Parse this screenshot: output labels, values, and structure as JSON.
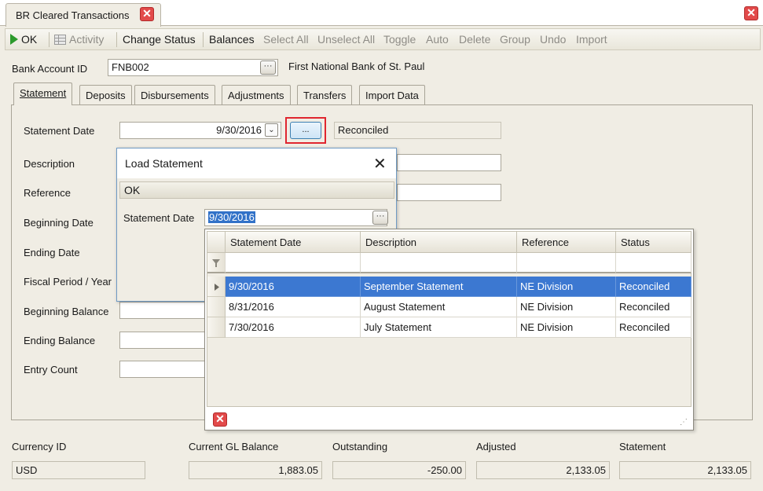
{
  "window": {
    "tab_title": "BR Cleared Transactions",
    "tab_close": "✕",
    "window_close": "✕"
  },
  "toolbar": {
    "ok": "OK",
    "activity": "Activity",
    "change_status": "Change Status",
    "balances": "Balances",
    "select_all": "Select All",
    "unselect_all": "Unselect All",
    "toggle": "Toggle",
    "auto": "Auto",
    "delete": "Delete",
    "group": "Group",
    "undo": "Undo",
    "import": "Import"
  },
  "header": {
    "bank_account_label": "Bank Account ID",
    "bank_account_value": "FNB002",
    "bank_name": "First National Bank of St. Paul"
  },
  "section_tabs": [
    "Statement",
    "Deposits",
    "Disbursements",
    "Adjustments",
    "Transfers",
    "Import Data"
  ],
  "statement_form": {
    "statement_date_label": "Statement Date",
    "statement_date_value": "9/30/2016",
    "lookup_button": "...",
    "status_value": "Reconciled",
    "description_label": "Description",
    "reference_label": "Reference",
    "beginning_date_label": "Beginning Date",
    "ending_date_label": "Ending Date",
    "fiscal_period_label": "Fiscal Period / Year",
    "beginning_balance_label": "Beginning Balance",
    "ending_balance_label": "Ending Balance",
    "entry_count_label": "Entry Count"
  },
  "load_dialog": {
    "title": "Load Statement",
    "close": "✕",
    "ok": "OK",
    "statement_date_label": "Statement Date",
    "statement_date_value": "9/30/2016"
  },
  "grid": {
    "columns": [
      "Statement Date",
      "Description",
      "Reference",
      "Status"
    ],
    "rows": [
      {
        "date": "9/30/2016",
        "description": "September Statement",
        "reference": "NE Division",
        "status": "Reconciled"
      },
      {
        "date": "8/31/2016",
        "description": "August Statement",
        "reference": "NE Division",
        "status": "Reconciled"
      },
      {
        "date": "7/30/2016",
        "description": "July Statement",
        "reference": "NE Division",
        "status": "Reconciled"
      }
    ],
    "selected_row": 0,
    "close": "✕"
  },
  "summary": {
    "currency_label": "Currency ID",
    "currency_value": "USD",
    "gl_balance_label": "Current GL Balance",
    "gl_balance_value": "1,883.05",
    "outstanding_label": "Outstanding",
    "outstanding_value": "-250.00",
    "adjusted_label": "Adjusted",
    "adjusted_value": "2,133.05",
    "statement_label": "Statement",
    "statement_value": "2,133.05"
  },
  "colors": {
    "accent_selection": "#3c78d1",
    "highlight_border": "#e0262f",
    "close_red": "#e24a4a",
    "ok_green": "#2c9a2c"
  }
}
